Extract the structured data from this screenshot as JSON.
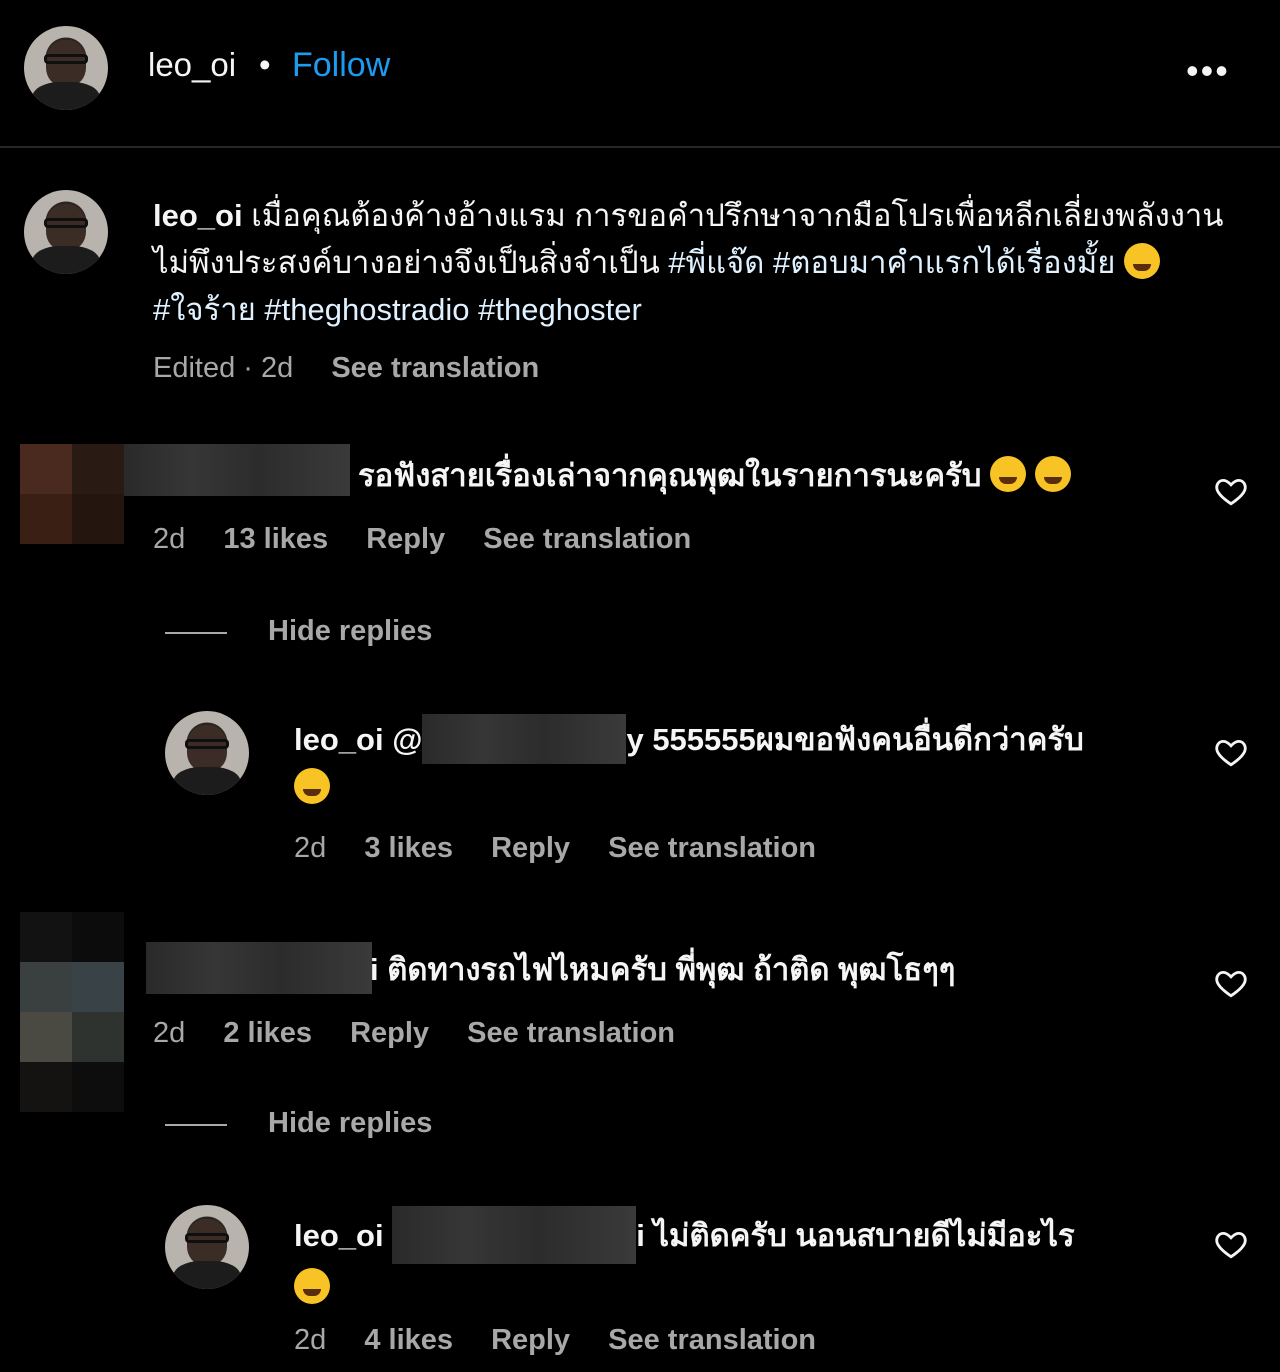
{
  "header": {
    "username": "leo_oi",
    "separator": "•",
    "follow_label": "Follow",
    "more_label": "•••"
  },
  "caption": {
    "username": "leo_oi",
    "text": " เมื่อคุณต้องค้างอ้างแรม การขอคำปรึกษาจากมือโปรเพื่อหลีกเลี่ยงพลังงานไม่พึงประสงค์บางอย่างจึงเป็นสิ่งจำเป็น",
    "tag1": "#พี่แจ๊ด",
    "tag2": "#ตอบมาคำแรกได้เรื่องมั้ย",
    "tag3": "#ใจร้าย",
    "tag4": "#theghostradio",
    "tag5": "#theghoster",
    "meta_edited": "Edited · 2d",
    "meta_translate": "See translation"
  },
  "comments": [
    {
      "text": "รอฟังสายเรื่องเล่าจากคุณพุฒในรายการนะครับ",
      "time": "2d",
      "likes": "13 likes",
      "reply": "Reply",
      "translate": "See translation",
      "hide_replies": "Hide replies",
      "reply_item": {
        "username": "leo_oi",
        "mention_prefix": "@",
        "mention_suffix": "y",
        "text": " 555555ผมขอฟังคนอื่นดีกว่าครับ",
        "time": "2d",
        "likes": "3 likes",
        "reply": "Reply",
        "translate": "See translation"
      }
    },
    {
      "text": "ติดทางรถไฟไหมครับ พี่พุฒ ถ้าติด พุฒโธๆๆ",
      "mention_suffix": "i",
      "time": "2d",
      "likes": "2 likes",
      "reply": "Reply",
      "translate": "See translation",
      "hide_replies": "Hide replies",
      "reply_item": {
        "username": "leo_oi",
        "mention_suffix": "i",
        "text": " ไม่ติดครับ นอนสบายดีไม่มีอะไร",
        "time": "2d",
        "likes": "4 likes",
        "reply": "Reply",
        "translate": "See translation"
      }
    }
  ],
  "colors": {
    "background": "#000000",
    "accent": "#1d9bf0",
    "secondary_text": "#a8a8a8"
  }
}
